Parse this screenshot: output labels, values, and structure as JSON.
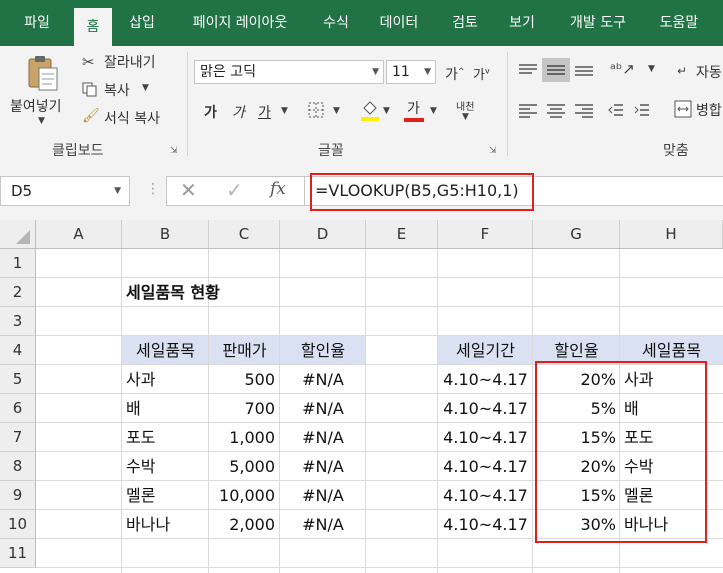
{
  "tabs": [
    "파일",
    "홈",
    "삽입",
    "페이지 레이아웃",
    "수식",
    "데이터",
    "검토",
    "보기",
    "개발 도구",
    "도움말"
  ],
  "active_tab": "홈",
  "ribbon": {
    "clipboard": {
      "paste": "붙여넣기",
      "cut": "잘라내기",
      "copy": "복사",
      "format_painter": "서식 복사",
      "group_label": "클립보드"
    },
    "font": {
      "font_name": "맑은 고딕",
      "font_size": "11",
      "grow": "가",
      "shrink": "가",
      "bold": "가",
      "italic": "가",
      "underline": "가",
      "font_color": "가",
      "phonetic": "내천",
      "group_label": "글꼴"
    },
    "alignment": {
      "wrap": "자동",
      "merge": "병합",
      "group_label": "맞춤"
    }
  },
  "formula_bar": {
    "name_box": "D5",
    "fx": "fx",
    "formula": "=VLOOKUP(B5,G5:H10,1)"
  },
  "grid": {
    "columns": [
      "A",
      "B",
      "C",
      "D",
      "E",
      "F",
      "G",
      "H"
    ],
    "rows": [
      "1",
      "2",
      "3",
      "4",
      "5",
      "6",
      "7",
      "8",
      "9",
      "10",
      "11"
    ],
    "title": "세일품목 현황",
    "left_table": {
      "headers": [
        "세일품목",
        "판매가",
        "할인율"
      ],
      "rows": [
        [
          "사과",
          "500",
          "#N/A"
        ],
        [
          "배",
          "700",
          "#N/A"
        ],
        [
          "포도",
          "1,000",
          "#N/A"
        ],
        [
          "수박",
          "5,000",
          "#N/A"
        ],
        [
          "멜론",
          "10,000",
          "#N/A"
        ],
        [
          "바나나",
          "2,000",
          "#N/A"
        ]
      ]
    },
    "right_table": {
      "headers": [
        "세일기간",
        "할인율",
        "세일품목"
      ],
      "rows": [
        [
          "4.10~4.17",
          "20%",
          "사과"
        ],
        [
          "4.10~4.17",
          "5%",
          "배"
        ],
        [
          "4.10~4.17",
          "15%",
          "포도"
        ],
        [
          "4.10~4.17",
          "20%",
          "수박"
        ],
        [
          "4.10~4.17",
          "15%",
          "멜론"
        ],
        [
          "4.10~4.17",
          "30%",
          "바나나"
        ]
      ]
    }
  },
  "colors": {
    "accent": "#217346",
    "header_fill": "#d9e1f2",
    "highlight": "#e0201b"
  }
}
